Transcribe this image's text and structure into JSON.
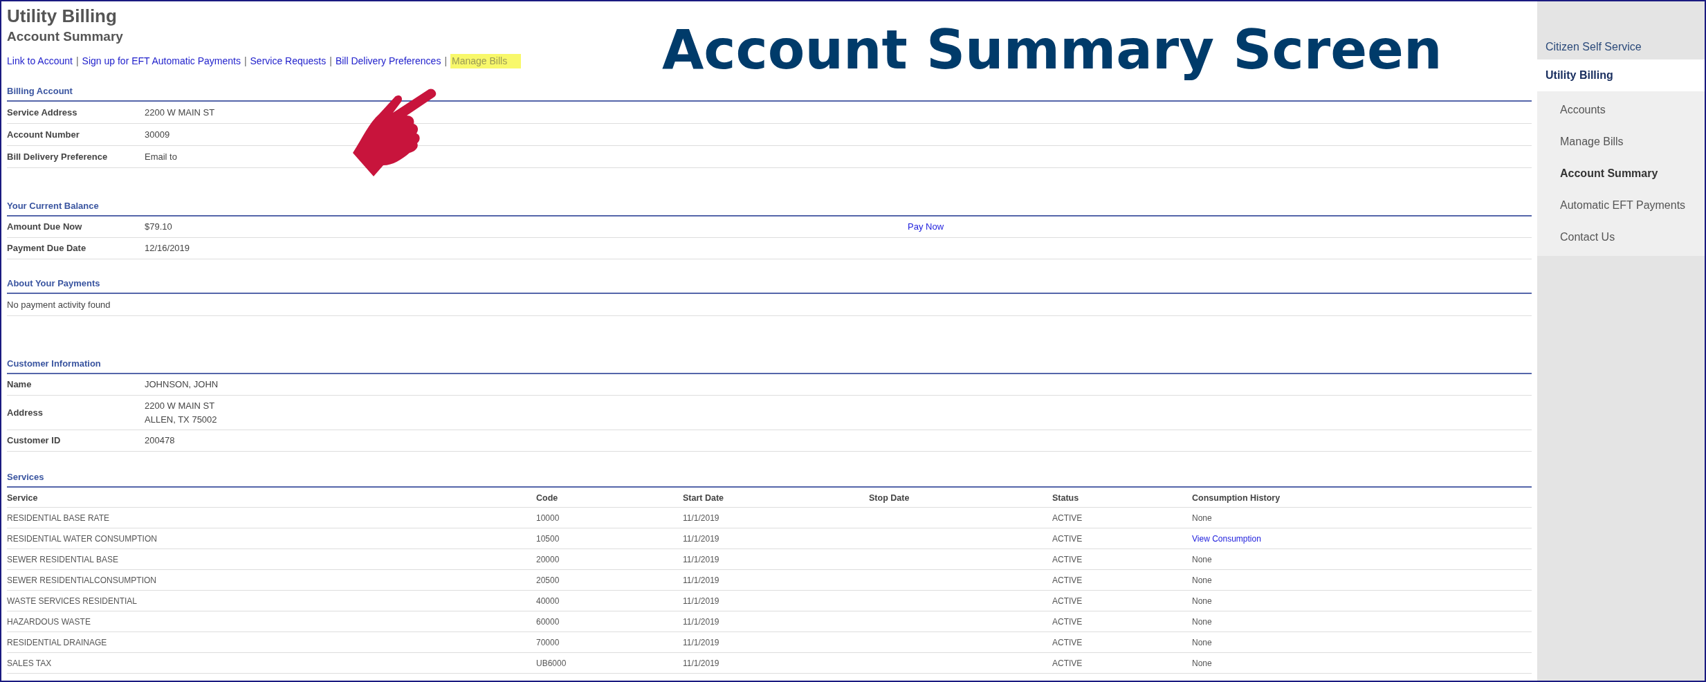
{
  "annotation": {
    "title": "Account Summary Screen"
  },
  "page": {
    "title": "Utility Billing",
    "subtitle": "Account Summary"
  },
  "links": [
    {
      "label": "Link to Account",
      "highlighted": false,
      "separator": "|"
    },
    {
      "label": "Sign up for EFT Automatic Payments",
      "highlighted": false,
      "separator": "|"
    },
    {
      "label": "Service Requests",
      "highlighted": false,
      "separator": "|"
    },
    {
      "label": "Bill Delivery Preferences",
      "highlighted": false,
      "separator": "|"
    },
    {
      "label": "Manage Bills",
      "highlighted": true
    }
  ],
  "billing_account": {
    "heading": "Billing Account",
    "rows": [
      {
        "label": "Service Address",
        "value": "2200 W MAIN ST"
      },
      {
        "label": "Account Number",
        "value": "30009"
      },
      {
        "label": "Bill Delivery Preference",
        "value": "Email to"
      }
    ]
  },
  "current_balance": {
    "heading": "Your Current Balance",
    "rows": [
      {
        "label": "Amount Due Now",
        "value": "$79.10",
        "action": "Pay Now"
      },
      {
        "label": "Payment Due Date",
        "value": "12/16/2019"
      }
    ]
  },
  "payments": {
    "heading": "About Your Payments",
    "message": "No payment activity found"
  },
  "customer_information": {
    "heading": "Customer Information",
    "rows": [
      {
        "label": "Name",
        "lines": [
          "JOHNSON, JOHN"
        ]
      },
      {
        "label": "Address",
        "lines": [
          "2200 W MAIN ST",
          "ALLEN, TX 75002"
        ]
      },
      {
        "label": "Customer ID",
        "lines": [
          "200478"
        ]
      }
    ]
  },
  "services": {
    "heading": "Services",
    "columns": [
      "Service",
      "Code",
      "Start Date",
      "Stop Date",
      "Status",
      "Consumption History"
    ],
    "rows": [
      {
        "service": "RESIDENTIAL BASE RATE",
        "code": "10000",
        "start_date": "11/1/2019",
        "status": "ACTIVE",
        "consumption": {
          "kind": "text",
          "label": "None"
        }
      },
      {
        "service": "RESIDENTIAL WATER CONSUMPTION",
        "code": "10500",
        "start_date": "11/1/2019",
        "status": "ACTIVE",
        "consumption": {
          "kind": "link",
          "label": "View Consumption"
        }
      },
      {
        "service": "SEWER RESIDENTIAL BASE",
        "code": "20000",
        "start_date": "11/1/2019",
        "status": "ACTIVE",
        "consumption": {
          "kind": "text",
          "label": "None"
        }
      },
      {
        "service": "SEWER RESIDENTIALCONSUMPTION",
        "code": "20500",
        "start_date": "11/1/2019",
        "status": "ACTIVE",
        "consumption": {
          "kind": "text",
          "label": "None"
        }
      },
      {
        "service": "WASTE SERVICES RESIDENTIAL",
        "code": "40000",
        "start_date": "11/1/2019",
        "status": "ACTIVE",
        "consumption": {
          "kind": "text",
          "label": "None"
        }
      },
      {
        "service": "HAZARDOUS WASTE",
        "code": "60000",
        "start_date": "11/1/2019",
        "status": "ACTIVE",
        "consumption": {
          "kind": "text",
          "label": "None"
        }
      },
      {
        "service": "RESIDENTIAL DRAINAGE",
        "code": "70000",
        "start_date": "11/1/2019",
        "status": "ACTIVE",
        "consumption": {
          "kind": "text",
          "label": "None"
        }
      },
      {
        "service": "SALES TAX",
        "code": "UB6000",
        "start_date": "11/1/2019",
        "status": "ACTIVE",
        "consumption": {
          "kind": "text",
          "label": "None"
        }
      }
    ]
  },
  "sidebar": {
    "title": "Citizen Self Service",
    "section": {
      "label": "Utility Billing",
      "selected": true
    },
    "items": [
      {
        "label": "Accounts",
        "selected": false
      },
      {
        "label": "Manage Bills",
        "selected": false
      },
      {
        "label": "Account Summary",
        "selected": true
      },
      {
        "label": "Automatic EFT Payments",
        "selected": false
      },
      {
        "label": "Contact Us",
        "selected": false
      }
    ]
  }
}
